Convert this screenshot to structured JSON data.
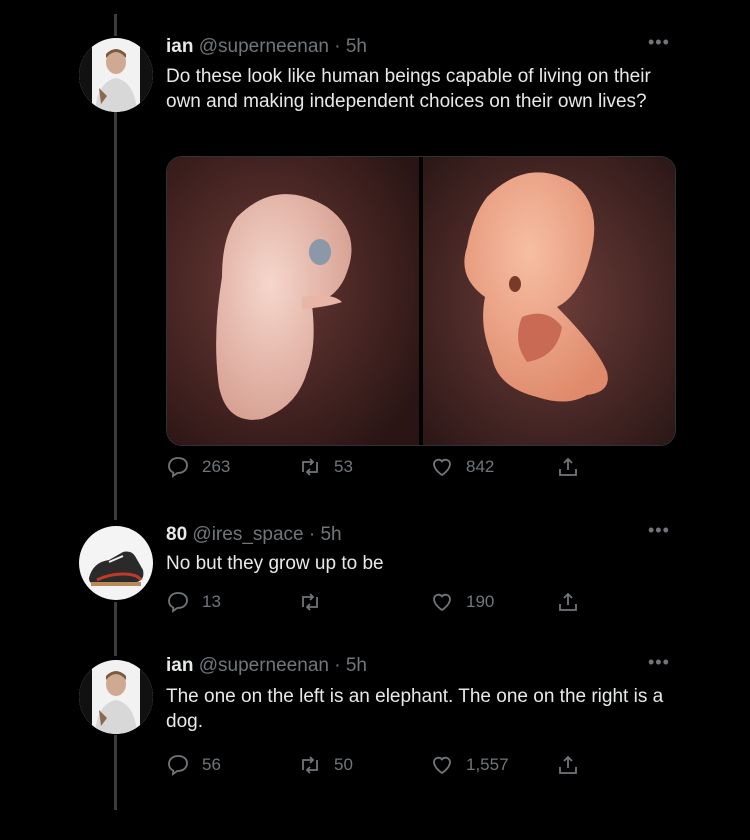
{
  "tweets": [
    {
      "name": "ian",
      "handle": "@superneenan",
      "time": "· 5h",
      "text": "Do these look like human beings capable of living on their own and making independent choices on their own lives?",
      "replies": "263",
      "retweets": "53",
      "likes": "842"
    },
    {
      "name": "80",
      "handle": "@ires_space",
      "time": "· 5h",
      "text": "No but they grow up to be",
      "replies": "13",
      "retweets": "",
      "likes": "190"
    },
    {
      "name": "ian",
      "handle": "@superneenan",
      "time": "· 5h",
      "text": "The one on the left is an elephant. The one on the right is a dog.",
      "replies": "56",
      "retweets": "50",
      "likes": "1,557"
    }
  ],
  "more_label": "•••",
  "colors": {
    "background": "#000000",
    "text": "#e7e9ea",
    "muted": "#71767b",
    "thread_line": "#3a3d40"
  },
  "icons": [
    "reply-icon",
    "retweet-icon",
    "like-icon",
    "share-icon",
    "more-icon"
  ]
}
